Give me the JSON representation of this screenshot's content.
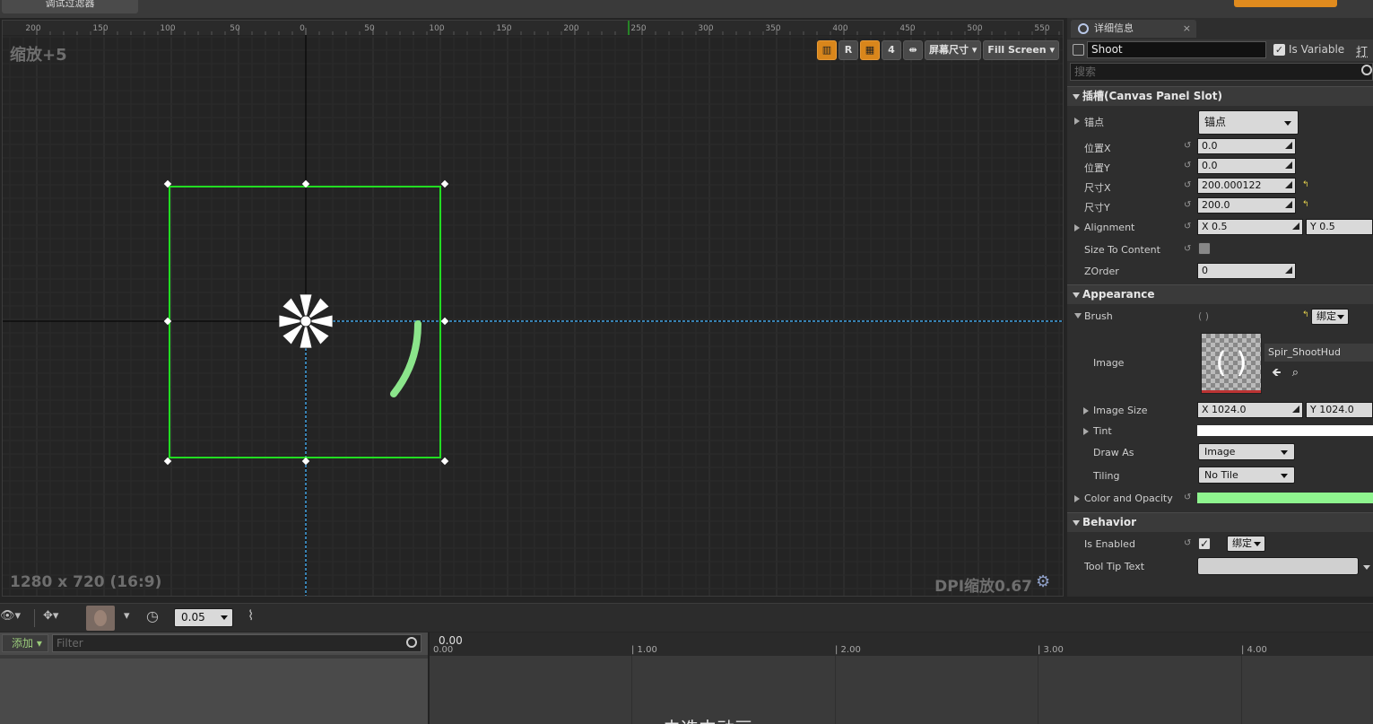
{
  "top": {
    "debug_filter_label": "调试过滤器"
  },
  "designer": {
    "zoom_label": "缩放+5",
    "resolution_label": "1280 x 720 (16:9)",
    "dpi_label": "DPI缩放0.67",
    "ruler_ticks": [
      "200",
      "150",
      "100",
      "50",
      "0",
      "50",
      "100",
      "150",
      "200",
      "250",
      "300",
      "350",
      "400",
      "450",
      "500",
      "550"
    ],
    "toolbar": {
      "r_label": "R",
      "grid_snap_value": "4",
      "screen_size_label": "屏幕尺寸",
      "fill_screen_label": "Fill Screen"
    },
    "colors": {
      "selection": "#22dd22",
      "guide": "#3fa0e0",
      "widget_arc": "#8be58b"
    }
  },
  "details": {
    "tab_label": "详细信息",
    "tab_close": "×",
    "widget_name": "Shoot",
    "is_variable_label": "Is Variable",
    "open_label": "打开",
    "search_placeholder": "搜索",
    "slot_section": "插槽(Canvas Panel Slot)",
    "anchors_label": "锚点",
    "anchors_value": "锚点",
    "pos_x_label": "位置X",
    "pos_x_value": "0.0",
    "pos_y_label": "位置Y",
    "pos_y_value": "0.0",
    "size_x_label": "尺寸X",
    "size_x_value": "200.000122",
    "size_y_label": "尺寸Y",
    "size_y_value": "200.0",
    "alignment_label": "Alignment",
    "alignment_x": "X  0.5",
    "alignment_y": "Y  0.5",
    "size_to_content_label": "Size To Content",
    "zorder_label": "ZOrder",
    "zorder_value": "0",
    "appearance_section": "Appearance",
    "brush_label": "Brush",
    "brush_preview": "( )",
    "bind_label": "绑定",
    "image_label": "Image",
    "image_asset": "Spir_ShootHud",
    "image_thumb_text": "( )",
    "image_size_label": "Image Size",
    "image_size_x": "X  1024.0",
    "image_size_y": "Y  1024.0",
    "tint_label": "Tint",
    "draw_as_label": "Draw As",
    "draw_as_value": "Image",
    "tiling_label": "Tiling",
    "tiling_value": "No Tile",
    "color_opacity_label": "Color and Opacity",
    "behavior_section": "Behavior",
    "is_enabled_label": "Is Enabled",
    "tooltip_label": "Tool Tip Text",
    "tooltip_value": "",
    "colors": {
      "tint": "#ffffff",
      "color_and_opacity": "#8ff58f"
    }
  },
  "animation": {
    "snap_value": "0.05",
    "add_label": "添加",
    "filter_placeholder": "Filter",
    "current_time": "0.00",
    "start_time": "0.00",
    "timeline_ticks": [
      "1.00",
      "2.00",
      "3.00",
      "4.00"
    ],
    "no_animation_text": "未选中动画"
  }
}
